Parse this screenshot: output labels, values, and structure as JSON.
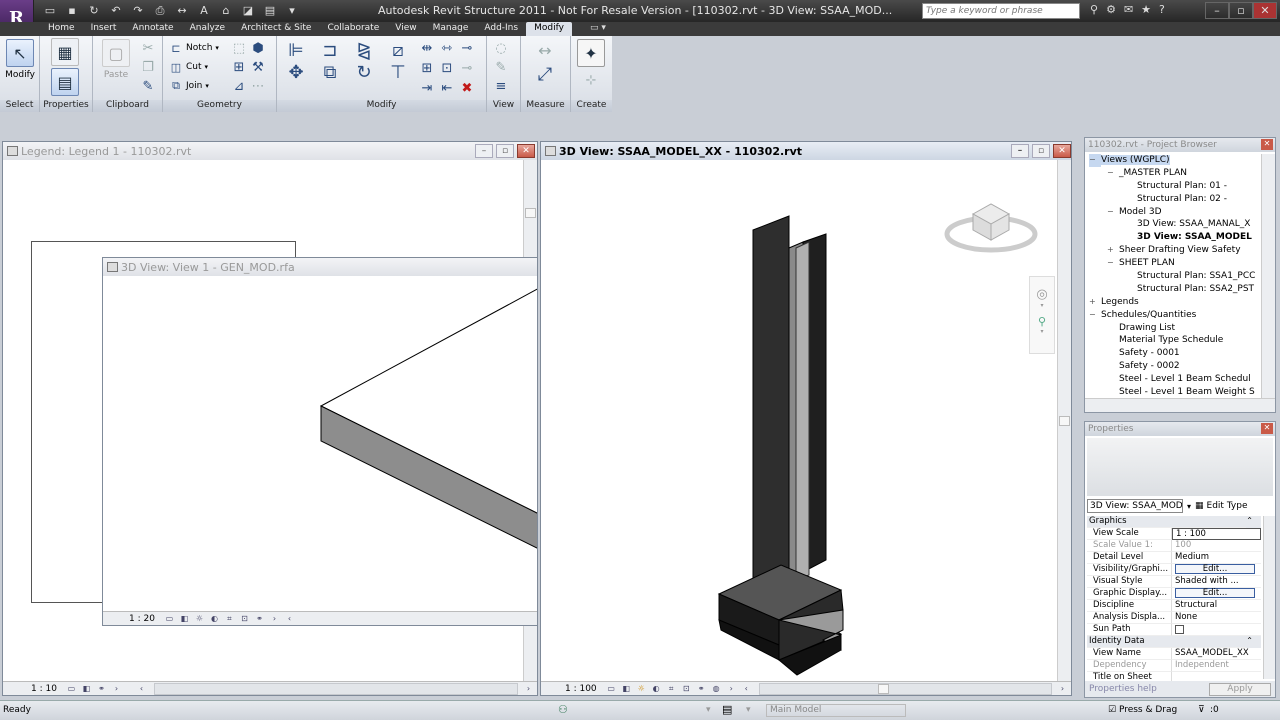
{
  "app": {
    "logo": "R",
    "title": "Autodesk Revit Structure 2011 - Not For Resale Version - [110302.rvt - 3D View: SSAA_MOD...",
    "search_placeholder": "Type a keyword or phrase"
  },
  "tabs": [
    "Home",
    "Insert",
    "Annotate",
    "Analyze",
    "Architect & Site",
    "Collaborate",
    "View",
    "Manage",
    "Add-Ins",
    "Modify"
  ],
  "active_tab": "Modify",
  "ribbon": {
    "select": {
      "button": "Modify",
      "label": "Select"
    },
    "properties": {
      "label": "Properties"
    },
    "clipboard": {
      "paste": "Paste",
      "label": "Clipboard"
    },
    "geometry": {
      "notch": "Notch",
      "cut": "Cut",
      "join": "Join",
      "label": "Geometry"
    },
    "modify": {
      "label": "Modify"
    },
    "view": {
      "label": "View"
    },
    "measure": {
      "label": "Measure"
    },
    "create": {
      "label": "Create"
    }
  },
  "windows": {
    "legend": {
      "title": "Legend: Legend 1 - 110302.rvt",
      "scale": "1 : 10"
    },
    "view1": {
      "title": "3D View: View 1 - GEN_MOD.rfa",
      "scale": "1 : 20"
    },
    "main3d": {
      "title": "3D View: SSAA_MODEL_XX - 110302.rvt",
      "scale": "1 : 100"
    }
  },
  "project_browser": {
    "title": "110302.rvt - Project Browser",
    "items": [
      {
        "label": "Views (WGPLC)",
        "indent": 0,
        "exp": "−",
        "sel": true
      },
      {
        "label": "_MASTER PLAN",
        "indent": 1,
        "exp": "−"
      },
      {
        "label": "Structural Plan: 01 -",
        "indent": 2,
        "exp": ""
      },
      {
        "label": "Structural Plan: 02 -",
        "indent": 2,
        "exp": ""
      },
      {
        "label": "Model 3D",
        "indent": 1,
        "exp": "−"
      },
      {
        "label": "3D View: SSAA_MANAL_X",
        "indent": 2,
        "exp": ""
      },
      {
        "label": "3D View: SSAA_MODEL",
        "indent": 2,
        "exp": "",
        "bold": true
      },
      {
        "label": "Sheer Drafting View Safety",
        "indent": 1,
        "exp": "+"
      },
      {
        "label": "SHEET PLAN",
        "indent": 1,
        "exp": "−"
      },
      {
        "label": "Structural Plan: SSA1_PCC",
        "indent": 2,
        "exp": ""
      },
      {
        "label": "Structural Plan: SSA2_PST",
        "indent": 2,
        "exp": ""
      },
      {
        "label": "Legends",
        "indent": 0,
        "exp": "+"
      },
      {
        "label": "Schedules/Quantities",
        "indent": 0,
        "exp": "−"
      },
      {
        "label": "Drawing List",
        "indent": 1,
        "exp": ""
      },
      {
        "label": "Material Type Schedule",
        "indent": 1,
        "exp": ""
      },
      {
        "label": "Safety - 0001",
        "indent": 1,
        "exp": ""
      },
      {
        "label": "Safety - 0002",
        "indent": 1,
        "exp": ""
      },
      {
        "label": "Steel - Level 1 Beam Schedul",
        "indent": 1,
        "exp": ""
      },
      {
        "label": "Steel - Level 1 Beam Weight S",
        "indent": 1,
        "exp": ""
      }
    ]
  },
  "properties": {
    "title": "Properties",
    "type_selector": "3D View: SSAA_MOD",
    "edit_type": "Edit Type",
    "rows": [
      {
        "k": "Graphics",
        "v": "",
        "group": true
      },
      {
        "k": "View Scale",
        "v": "1 : 100",
        "box": true
      },
      {
        "k": "Scale Value    1:",
        "v": "100",
        "dim": true
      },
      {
        "k": "Detail Level",
        "v": "Medium"
      },
      {
        "k": "Visibility/Graphi...",
        "v": "Edit...",
        "btn": true
      },
      {
        "k": "Visual Style",
        "v": "Shaded with ..."
      },
      {
        "k": "Graphic Display...",
        "v": "Edit...",
        "btn": true
      },
      {
        "k": "Discipline",
        "v": "Structural"
      },
      {
        "k": "Analysis Displa...",
        "v": "None"
      },
      {
        "k": "Sun Path",
        "v": "",
        "check": true
      },
      {
        "k": "Identity Data",
        "v": "",
        "group": true
      },
      {
        "k": "View Name",
        "v": "SSAA_MODEL_XX"
      },
      {
        "k": "Dependency",
        "v": "Independent",
        "dim": true
      },
      {
        "k": "Title on Sheet",
        "v": ""
      }
    ],
    "help_link": "Properties help",
    "apply": "Apply"
  },
  "status": {
    "text": "Ready",
    "workset": "Main Model",
    "press_drag": "Press & Drag",
    "filter_count": ":0"
  }
}
